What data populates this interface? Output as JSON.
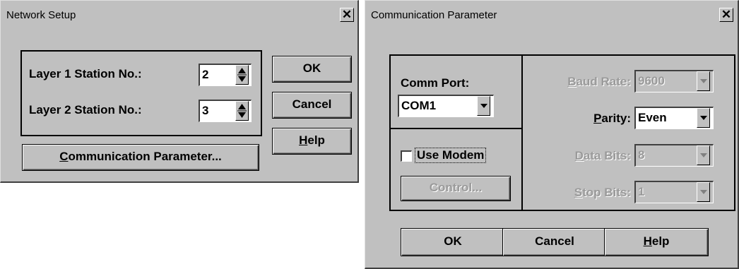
{
  "network_setup": {
    "title": "Network Setup",
    "close_glyph": "✕",
    "layer1_label": "Layer 1 Station No.:",
    "layer1_value": "2",
    "layer2_label": "Layer 2 Station No.:",
    "layer2_value": "3",
    "ok_label": "OK",
    "cancel_label": "Cancel",
    "help_label_mn": "H",
    "help_label_rest": "elp",
    "comm_param_mn": "C",
    "comm_param_rest": "ommunication Parameter..."
  },
  "comm_param": {
    "title": "Communication Parameter",
    "close_glyph": "✕",
    "comm_port_label": "Comm Port:",
    "comm_port_value": "COM1",
    "use_modem_label": "Use Modem",
    "use_modem_checked": false,
    "control_label": "Control...",
    "baud_rate_mn": "B",
    "baud_rate_rest": "aud Rate:",
    "baud_rate_value": "9600",
    "parity_mn": "P",
    "parity_rest": "arity:",
    "parity_value": "Even",
    "data_bits_mn": "D",
    "data_bits_rest": "ata Bits:",
    "data_bits_value": "8",
    "stop_bits_mn": "S",
    "stop_bits_rest": "top Bits:",
    "stop_bits_value": "1",
    "ok_label": "OK",
    "cancel_label": "Cancel",
    "help_mn": "H",
    "help_rest": "elp"
  }
}
